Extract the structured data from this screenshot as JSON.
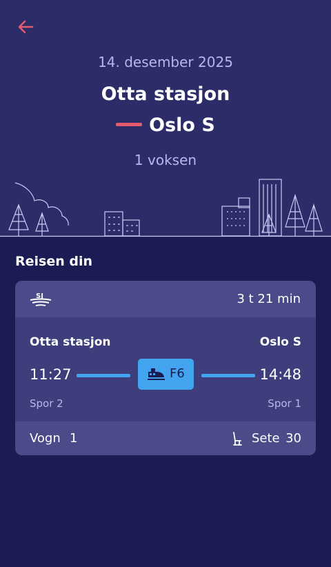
{
  "header": {
    "date": "14. desember 2025",
    "from_station": "Otta stasjon",
    "to_station": "Oslo S",
    "passengers": "1 voksen"
  },
  "section": {
    "title": "Reisen din"
  },
  "trip": {
    "duration": "3 t 21 min",
    "from_station": "Otta stasjon",
    "to_station": "Oslo S",
    "departure_time": "11:27",
    "arrival_time": "14:48",
    "train_code": "F6",
    "from_platform": "Spor 2",
    "to_platform": "Spor 1",
    "car_label": "Vogn",
    "car_value": "1",
    "seat_label": "Sete",
    "seat_value": "30"
  },
  "icons": {
    "back": "arrow-left-icon",
    "operator": "sj-logo-icon",
    "train": "train-icon",
    "seat": "seat-icon"
  },
  "colors": {
    "background": "#1b1c54",
    "header": "#2b2c68",
    "accent_red": "#e35c6d",
    "accent_blue": "#42a3ef",
    "muted_text": "#b7b8ea"
  }
}
